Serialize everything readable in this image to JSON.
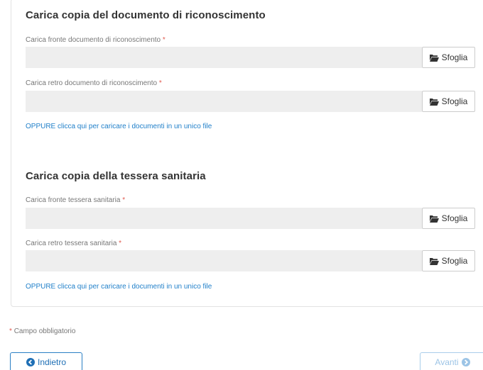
{
  "doc_section": {
    "title": "Carica copia del documento di riconoscimento",
    "front_label": "Carica fronte documento di riconoscimento",
    "back_label": "Carica retro documento di riconoscimento",
    "single_file_link": "OPPURE clicca qui per caricare i documenti in un unico file"
  },
  "health_section": {
    "title": "Carica copia della tessera sanitaria",
    "front_label": "Carica fronte tessera sanitaria",
    "back_label": "Carica retro tessera sanitaria",
    "single_file_link": "OPPURE clicca qui per caricare i documenti in un unico file"
  },
  "common": {
    "required_marker": "*",
    "browse_label": "Sfoglia",
    "browse_icon": "folder-open-icon"
  },
  "footer": {
    "required_note": "Campo obbligatorio",
    "back_label": "Indietro",
    "next_label": "Avanti"
  },
  "colors": {
    "accent": "#1f7fc9",
    "required": "#e05a4f",
    "input_bg": "#eeeeee",
    "next_disabled": "#9cc4e6"
  }
}
